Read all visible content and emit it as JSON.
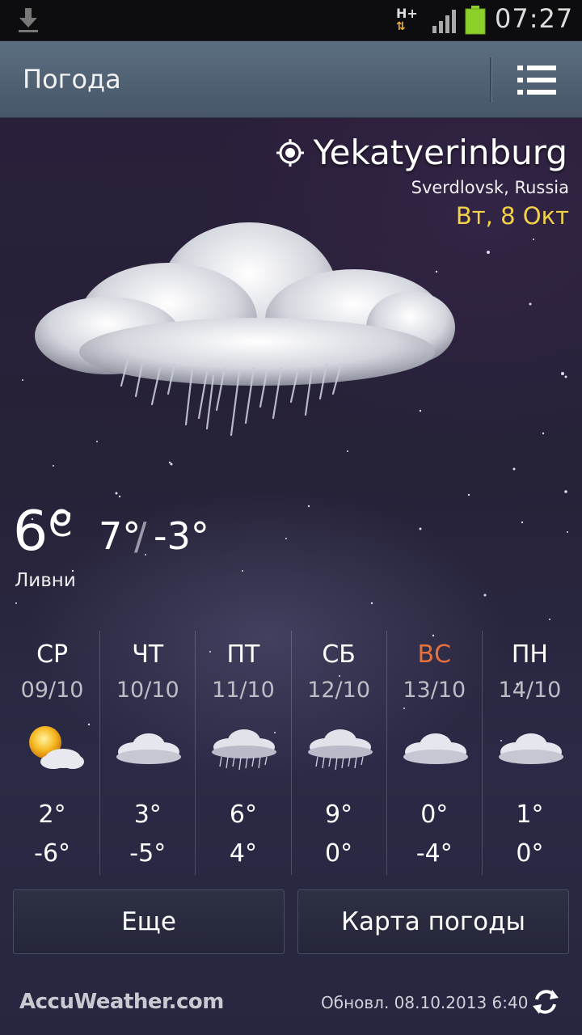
{
  "status_bar": {
    "network": "H+",
    "time": "07:27"
  },
  "app_bar": {
    "title": "Погода"
  },
  "location": {
    "city": "Yekatyerinburg",
    "region": "Sverdlovsk, Russia",
    "date": "Вт, 8 Окт"
  },
  "current": {
    "temp": "6°",
    "unit": "C",
    "high": "7°",
    "slash": "/",
    "low": "-3°",
    "description": "Ливни",
    "icon": "rain-cloud-icon"
  },
  "forecast": [
    {
      "day": "СР",
      "date": "09/10",
      "high": "2°",
      "low": "-6°",
      "icon": "partly-sunny-icon"
    },
    {
      "day": "ЧТ",
      "date": "10/10",
      "high": "3°",
      "low": "-5°",
      "icon": "cloud-icon"
    },
    {
      "day": "ПТ",
      "date": "11/10",
      "high": "6°",
      "low": "4°",
      "icon": "rain-cloud-icon"
    },
    {
      "day": "СБ",
      "date": "12/10",
      "high": "9°",
      "low": "0°",
      "icon": "rain-cloud-icon"
    },
    {
      "day": "ВС",
      "date": "13/10",
      "high": "0°",
      "low": "-4°",
      "icon": "cloud-icon"
    },
    {
      "day": "ПН",
      "date": "14/10",
      "high": "1°",
      "low": "0°",
      "icon": "cloud-icon"
    }
  ],
  "buttons": {
    "more": "Еще",
    "map": "Карта погоды"
  },
  "footer": {
    "brand": "AccuWeather.com",
    "updated": "Обновл. 08.10.2013 6:40"
  },
  "colors": {
    "date_accent": "#f3d24a",
    "sunday": "#e8703c"
  }
}
